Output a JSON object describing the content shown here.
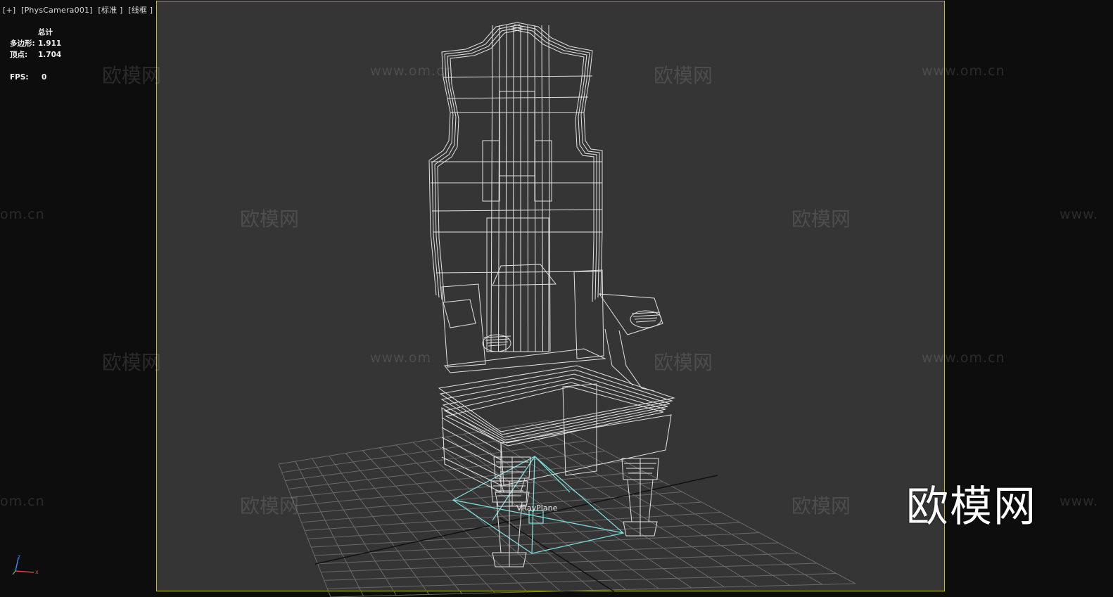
{
  "viewport": {
    "label_plus": "[+]",
    "label_camera": "[PhysCamera001]",
    "label_shading": "[标准 ]",
    "label_mode": "[线框 ]"
  },
  "stats": {
    "total_label": "总计",
    "poly_label": "多边形:",
    "poly_value": "1.911",
    "vert_label": "顶点:",
    "vert_value": "1.704",
    "fps_label": "FPS:",
    "fps_value": "0"
  },
  "scene": {
    "object_label": "VRayPlane",
    "wireframe_color": "#f2f2f2",
    "plane_color": "#7fe3e3",
    "grid_color": "#6a6a6a",
    "safe_frame_color": "#c9c221",
    "background_color": "#353535"
  },
  "axis_gizmo": {
    "x_label": "x",
    "z_label": "z"
  },
  "watermarks": {
    "brand_big": "欧模网",
    "brand_small": "欧模网",
    "url": "www.om.cn",
    "url_partial": "om.cn",
    "url_partial_right": "www.",
    "url_cut": "www.om"
  }
}
